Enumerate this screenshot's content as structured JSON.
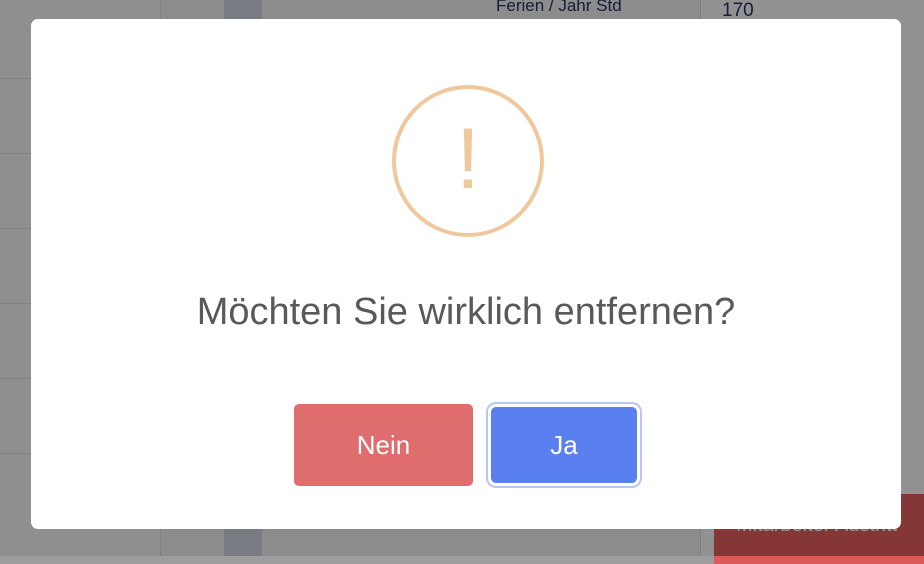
{
  "background": {
    "row_label": "Ferien / Jahr Std",
    "row_value": "170",
    "action_button_label": "Mitarbeiter Austritt"
  },
  "dialog": {
    "icon": "exclamation-icon",
    "title": "Möchten Sie wirklich entfernen?",
    "cancel_label": "Nein",
    "confirm_label": "Ja"
  },
  "colors": {
    "icon_color": "#f0c89d",
    "cancel_color": "#e06d6d",
    "confirm_color": "#5a80f0"
  }
}
